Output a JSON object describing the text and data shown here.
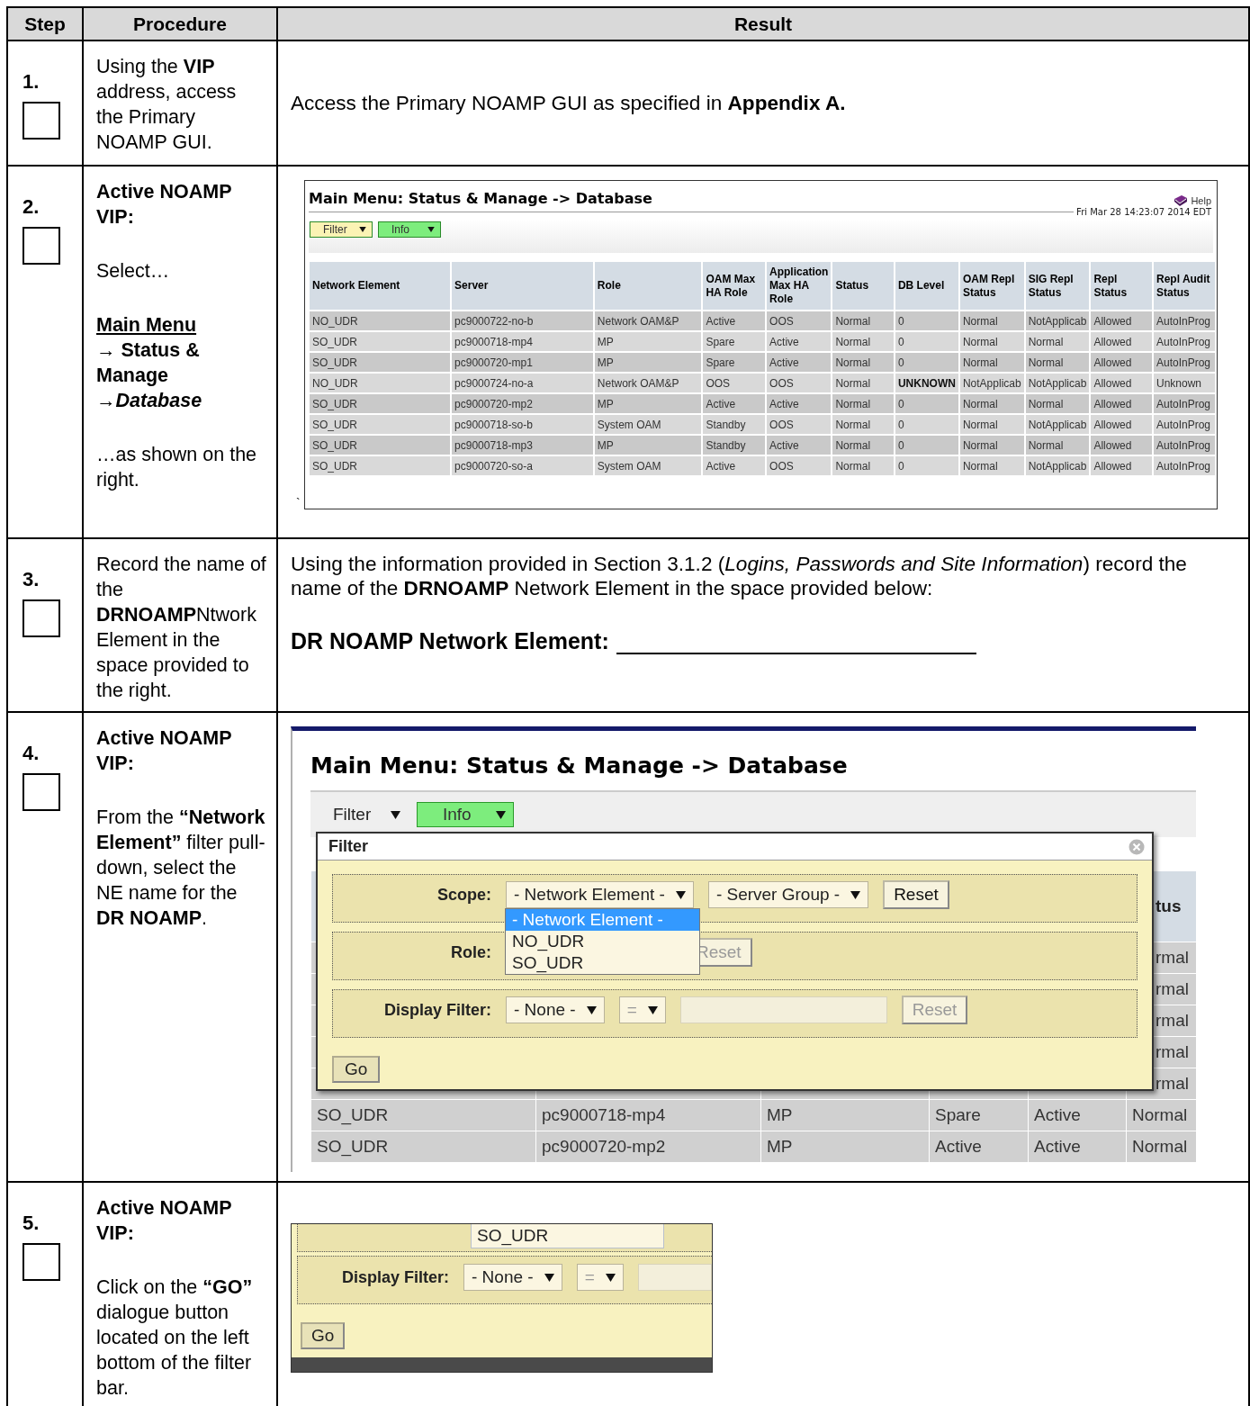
{
  "table": {
    "columns": [
      "Step",
      "Procedure",
      "Result"
    ],
    "steps": [
      {
        "number": "1.",
        "checked": false,
        "procedure": [
          {
            "kind": "text",
            "text": "Using the **VIP** address, access the Primary NOAMP GUI."
          }
        ],
        "result": {
          "kind": "text",
          "paragraphs": [
            {
              "kind": "text",
              "text": "Access the Primary NOAMP GUI as specified in **Appendix A.**"
            }
          ]
        }
      },
      {
        "number": "2.",
        "checked": false,
        "procedure": [
          {
            "kind": "heading",
            "text": "Active NOAMP VIP:"
          },
          {
            "kind": "text",
            "text": "Select…"
          },
          {
            "kind": "menu-path",
            "items": [
              {
                "kind": "link",
                "text": "Main Menu"
              },
              {
                "kind": "step",
                "text": "→ Status & Manage"
              },
              {
                "kind": "current",
                "text": "→Database"
              }
            ]
          },
          {
            "kind": "text",
            "text": "…as shown on the right."
          }
        ],
        "result": {
          "kind": "database-screen",
          "stray_mark": "`",
          "screen": {
            "title": "Main Menu: Status & Manage -> Database",
            "help": "Help",
            "timestamp": "Fri Mar 28 14:23:07 2014 EDT",
            "toolbar": [
              {
                "label": "Filter",
                "kind": "colored",
                "color": "#fbf3b4"
              },
              {
                "label": "Info",
                "kind": "colored",
                "color": "#7ded7d"
              }
            ],
            "columns": [
              "Network Element",
              "Server",
              "Role",
              "OAM Max HA Role",
              "Application Max HA Role",
              "Status",
              "DB Level",
              "OAM Repl Status",
              "SIG Repl Status",
              "Repl Status",
              "Repl Audit Status"
            ],
            "rows": [
              [
                "NO_UDR",
                "pc9000722-no-b",
                "Network OAM&P",
                "Active",
                "OOS",
                "Normal",
                "0",
                "Normal",
                "NotApplicab",
                "Allowed",
                "AutoInProg"
              ],
              [
                "SO_UDR",
                "pc9000718-mp4",
                "MP",
                "Spare",
                "Active",
                "Normal",
                "0",
                "Normal",
                "Normal",
                "Allowed",
                "AutoInProg"
              ],
              [
                "SO_UDR",
                "pc9000720-mp1",
                "MP",
                "Spare",
                "Active",
                "Normal",
                "0",
                "Normal",
                "Normal",
                "Allowed",
                "AutoInProg"
              ],
              [
                "NO_UDR",
                "pc9000724-no-a",
                "Network OAM&P",
                "OOS",
                "OOS",
                "Normal",
                {
                  "text": "UNKNOWN",
                  "bold": true
                },
                "NotApplicab",
                "NotApplicab",
                "Allowed",
                "Unknown"
              ],
              [
                "SO_UDR",
                "pc9000720-mp2",
                "MP",
                "Active",
                "Active",
                "Normal",
                "0",
                "Normal",
                "Normal",
                "Allowed",
                "AutoInProg"
              ],
              [
                "SO_UDR",
                "pc9000718-so-b",
                "System OAM",
                "Standby",
                "OOS",
                "Normal",
                "0",
                "Normal",
                "NotApplicab",
                "Allowed",
                "AutoInProg"
              ],
              [
                "SO_UDR",
                "pc9000718-mp3",
                "MP",
                "Standby",
                "Active",
                "Normal",
                "0",
                "Normal",
                "Normal",
                "Allowed",
                "AutoInProg"
              ],
              [
                "SO_UDR",
                "pc9000720-so-a",
                "System OAM",
                "Active",
                "OOS",
                "Normal",
                "0",
                "Normal",
                "NotApplicab",
                "Allowed",
                "AutoInProg"
              ]
            ]
          }
        }
      },
      {
        "number": "3.",
        "checked": false,
        "procedure": [
          {
            "kind": "text",
            "text": "Record the name of the **DRNOAMP**Ntwork Element in the space provided to the right."
          }
        ],
        "result": {
          "kind": "text",
          "paragraphs": [
            {
              "kind": "text",
              "text": "Using the information provided in Section 3.1.2 (*Logins, Passwords and Site Information*) record the name of the **DRNOAMP** Network Element in the space provided below:"
            },
            {
              "kind": "fill-in",
              "label": "DR NOAMP Network Element:"
            }
          ]
        }
      },
      {
        "number": "4.",
        "checked": false,
        "procedure": [
          {
            "kind": "heading",
            "text": "Active NOAMP VIP:"
          },
          {
            "kind": "text",
            "text": "From the **“Network Element”** filter pull-down, select the NE name for the **DR NOAMP**."
          }
        ],
        "result": {
          "kind": "filter-screen",
          "screen": {
            "title": "Main Menu: Status & Manage -> Database",
            "toolbar": [
              {
                "label": "Filter",
                "kind": "plain"
              },
              {
                "label": "Info",
                "kind": "colored",
                "color": "#7ded7d"
              }
            ],
            "background": {
              "header": "tus",
              "column_cells": [
                "rmal",
                "rmal",
                "rmal",
                "rmal",
                "rmal"
              ],
              "rows": [
                [
                  "SO_UDR",
                  "pc9000718-mp4",
                  "MP",
                  "Spare",
                  "Active",
                  "Normal"
                ],
                [
                  "SO_UDR",
                  "pc9000720-mp2",
                  "MP",
                  "Active",
                  "Active",
                  "Normal"
                ]
              ]
            },
            "dialog": {
              "title": "Filter",
              "groups": [
                {
                  "label": "Scope:",
                  "controls": [
                    {
                      "kind": "select",
                      "value": "- Network Element -",
                      "open": true,
                      "options": [
                        {
                          "text": "- Network Element -",
                          "selected": true
                        },
                        {
                          "text": "NO_UDR",
                          "selected": false
                        },
                        {
                          "text": "SO_UDR",
                          "selected": false
                        }
                      ]
                    },
                    {
                      "kind": "select",
                      "value": "- Server Group -"
                    },
                    {
                      "kind": "button",
                      "label": "Reset",
                      "disabled": false
                    }
                  ]
                },
                {
                  "label": "Role:",
                  "controls": [
                    {
                      "kind": "button",
                      "label": "Reset",
                      "disabled": true
                    }
                  ]
                },
                {
                  "label": "Display Filter:",
                  "controls": [
                    {
                      "kind": "select",
                      "value": "- None -"
                    },
                    {
                      "kind": "select",
                      "value": "=",
                      "disabled": true
                    },
                    {
                      "kind": "input",
                      "disabled": true
                    },
                    {
                      "kind": "button",
                      "label": "Reset",
                      "disabled": true
                    }
                  ]
                }
              ],
              "go": "Go"
            }
          }
        }
      },
      {
        "number": "5.",
        "checked": false,
        "procedure": [
          {
            "kind": "heading",
            "text": "Active NOAMP VIP:"
          },
          {
            "kind": "text",
            "text": "Click on the **“GO”** dialogue button located on the left bottom of the filter bar."
          }
        ],
        "result": {
          "kind": "go-screen",
          "screen": {
            "top_value": "SO_UDR",
            "group": {
              "label": "Display Filter:",
              "controls": [
                {
                  "kind": "select",
                  "value": "- None -"
                },
                {
                  "kind": "select",
                  "value": "=",
                  "disabled": true
                },
                {
                  "kind": "input",
                  "disabled": true
                }
              ]
            },
            "go": "Go"
          }
        }
      }
    ]
  }
}
